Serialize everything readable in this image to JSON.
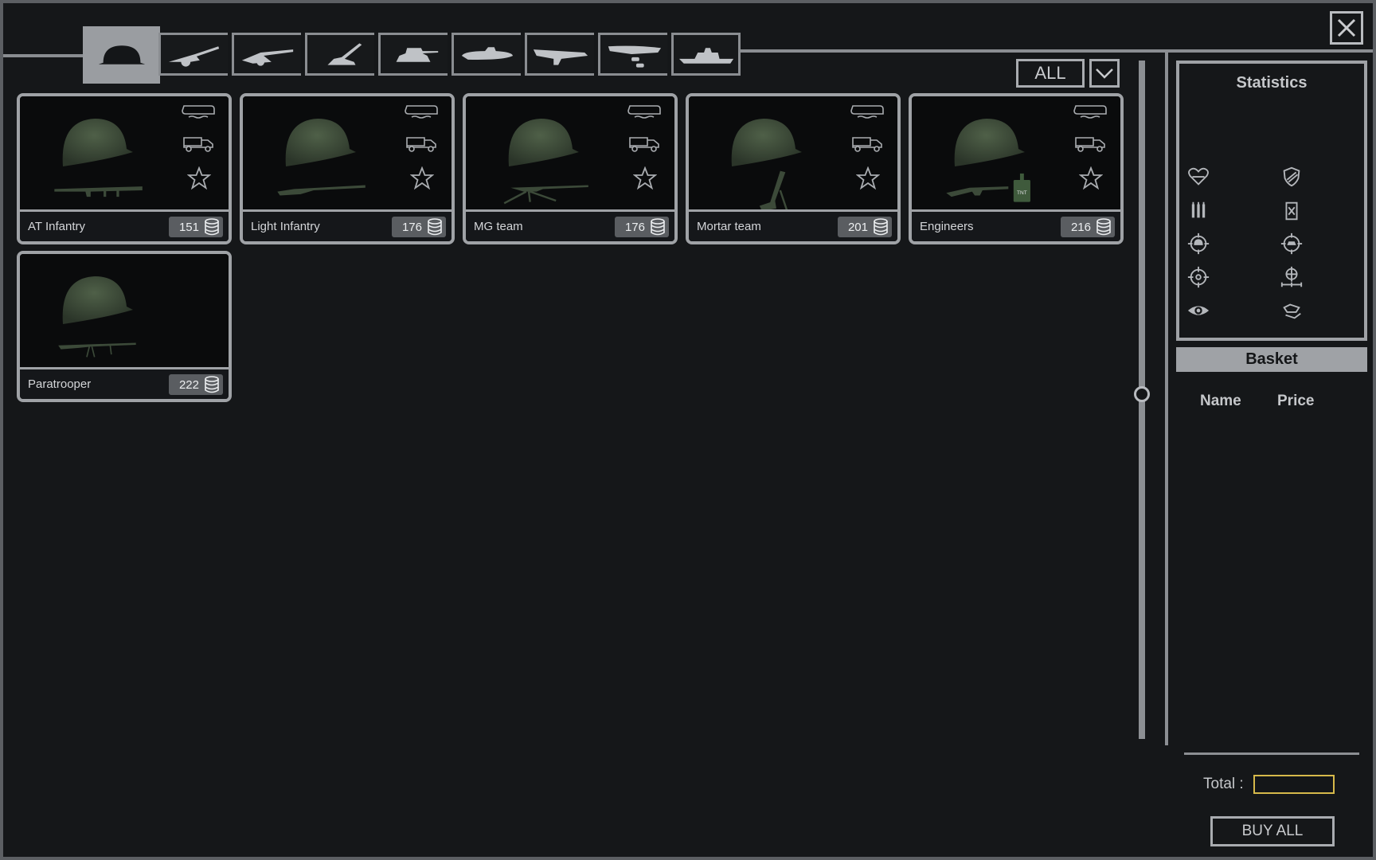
{
  "tabs": [
    {
      "icon": "infantry-helmet-icon",
      "active": true
    },
    {
      "icon": "field-gun-icon",
      "active": false
    },
    {
      "icon": "anti-tank-gun-icon",
      "active": false
    },
    {
      "icon": "anti-air-gun-icon",
      "active": false
    },
    {
      "icon": "tank-icon",
      "active": false
    },
    {
      "icon": "submarine-icon",
      "active": false
    },
    {
      "icon": "fighter-plane-icon",
      "active": false
    },
    {
      "icon": "bomber-plane-icon",
      "active": false
    },
    {
      "icon": "warship-icon",
      "active": false
    }
  ],
  "filter": {
    "label": "ALL"
  },
  "units": [
    {
      "name": "AT Infantry",
      "price": "151",
      "weapon": "bazooka"
    },
    {
      "name": "Light Infantry",
      "price": "176",
      "weapon": "rifle"
    },
    {
      "name": "MG team",
      "price": "176",
      "weapon": "machine-gun"
    },
    {
      "name": "Mortar team",
      "price": "201",
      "weapon": "mortar"
    },
    {
      "name": "Engineers",
      "price": "216",
      "weapon": "smg-tnt"
    },
    {
      "name": "Paratrooper",
      "price": "222",
      "weapon": "lmg"
    }
  ],
  "tnt_label": "TNT",
  "statistics": {
    "title": "Statistics",
    "icons": [
      "health-heart-icon",
      "armor-shield-icon",
      "ammo-icon",
      "fuel-can-icon",
      "soft-target-icon",
      "hard-target-icon",
      "accuracy-icon",
      "range-icon",
      "vision-eye-icon",
      "transport-icon"
    ]
  },
  "basket": {
    "title": "Basket",
    "col_name": "Name",
    "col_price": "Price",
    "total_label": "Total :",
    "total_value": "",
    "buy_all_label": "BUY ALL"
  },
  "colors": {
    "background": "#141618",
    "border": "#9fa2a6",
    "accent_total": "#d6b94a",
    "helmet_green": "#4a5a45"
  }
}
